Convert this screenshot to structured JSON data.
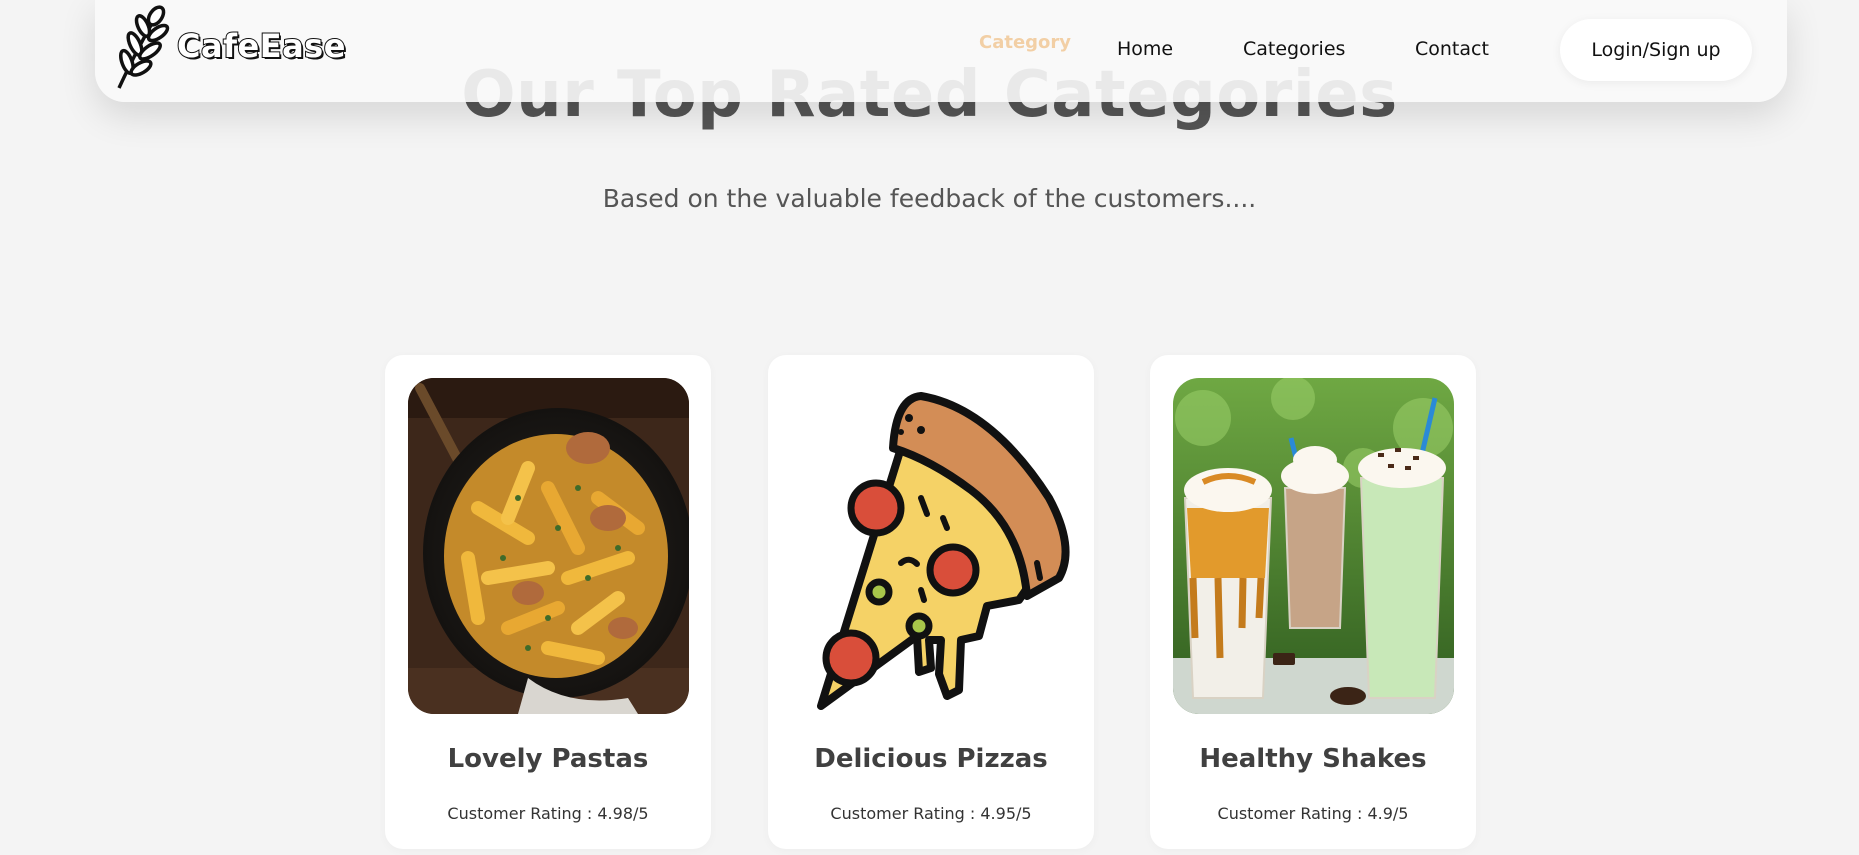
{
  "nav": {
    "logo_text": "CafeEase",
    "highlight_label": "Category",
    "links": [
      "Home",
      "Categories",
      "Contact"
    ],
    "login_label": "Login/Sign up",
    "highlight_color": "#f2cfa5"
  },
  "hero": {
    "title": "Our Top Rated Categories",
    "subtitle": "Based on the valuable feedback of the customers...."
  },
  "categories": [
    {
      "name": "Lovely Pastas",
      "rating_text": "Customer Rating : 4.98/5",
      "image": "pasta-photo"
    },
    {
      "name": "Delicious Pizzas",
      "rating_text": "Customer Rating : 4.95/5",
      "image": "pizza-slice-illustration"
    },
    {
      "name": "Healthy Shakes",
      "rating_text": "Customer Rating : 4.9/5",
      "image": "milkshakes-photo"
    }
  ]
}
